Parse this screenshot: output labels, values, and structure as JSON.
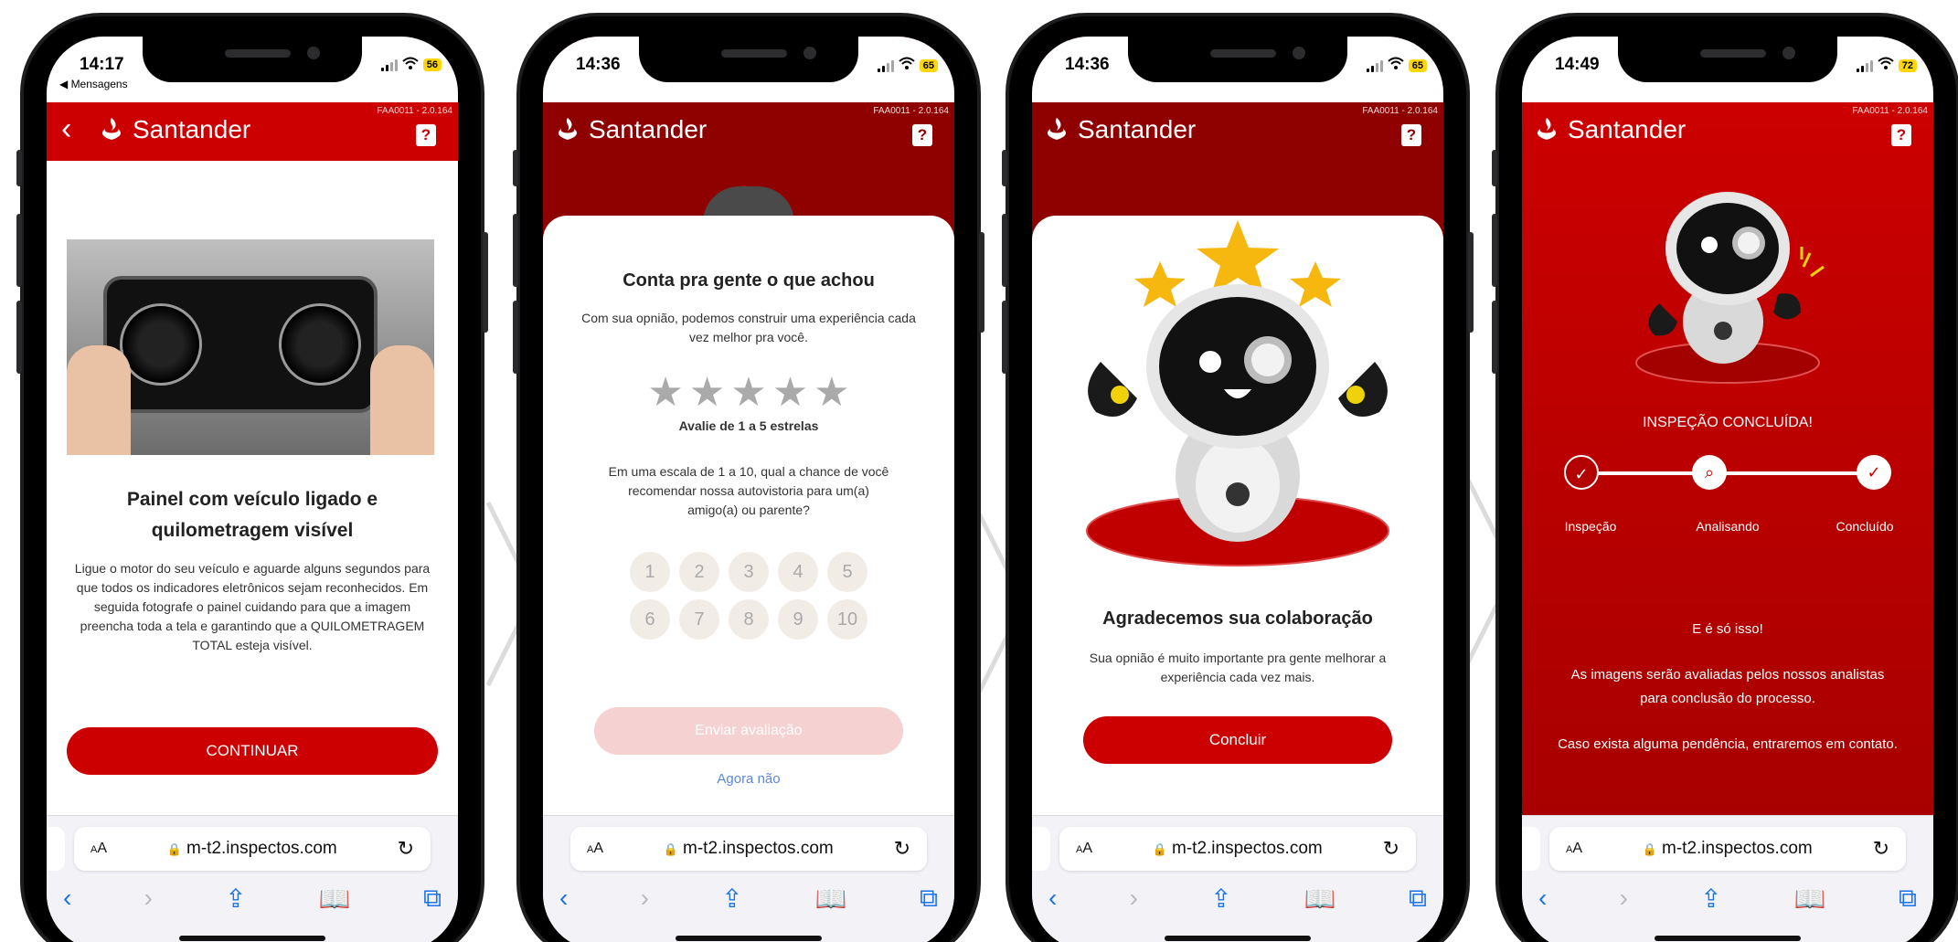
{
  "version": "FAA0011 - 2.0.164",
  "brand": "Santander",
  "url": "m-t2.inspectos.com",
  "colors": {
    "brand_red": "#cc0000",
    "dark_red": "#8f0000",
    "battery_yellow": "#ffd60a",
    "link_blue": "#5b87d6"
  },
  "screens": [
    {
      "status": {
        "time": "14:17",
        "battery": "56",
        "back_app": "◀ Mensagens"
      },
      "title": "Painel com veículo ligado e quilometragem visível",
      "body": "Ligue o motor do seu veículo e aguarde alguns segundos para que todos os indicadores eletrônicos sejam reconhecidos. Em seguida fotografe o painel cuidando para que a imagem preencha toda a tela e garantindo que a QUILOMETRAGEM TOTAL esteja visível.",
      "button": "CONTINUAR"
    },
    {
      "status": {
        "time": "14:36",
        "battery": "65"
      },
      "title": "Conta pra gente o que achou",
      "subtitle": "Com sua opnião, podemos construir uma experiência cada vez melhor pra você.",
      "rating_label": "Avalie de 1 a 5 estrelas",
      "question": "Em uma escala de 1 a 10, qual a chance de você recomendar nossa autovistoria para um(a) amigo(a) ou parente?",
      "numbers_row1": [
        "1",
        "2",
        "3",
        "4",
        "5"
      ],
      "numbers_row2": [
        "6",
        "7",
        "8",
        "9",
        "10"
      ],
      "send_button": "Enviar avaliação",
      "later_link": "Agora não"
    },
    {
      "status": {
        "time": "14:36",
        "battery": "65"
      },
      "title": "Agradecemos sua colaboração",
      "subtitle": "Sua opnião é muito importante pra gente melhorar a experiência cada vez mais.",
      "button": "Concluir"
    },
    {
      "status": {
        "time": "14:49",
        "battery": "72"
      },
      "done_label": "INSPEÇÃO CONCLUÍDA!",
      "steps": [
        "Inspeção",
        "Analisando",
        "Concluído"
      ],
      "line1": "E é só isso!",
      "line2": "As imagens serão avaliadas pelos nossos analistas para conclusão do processo.",
      "line3": "Caso exista alguma pendência, entraremos em contato."
    }
  ]
}
